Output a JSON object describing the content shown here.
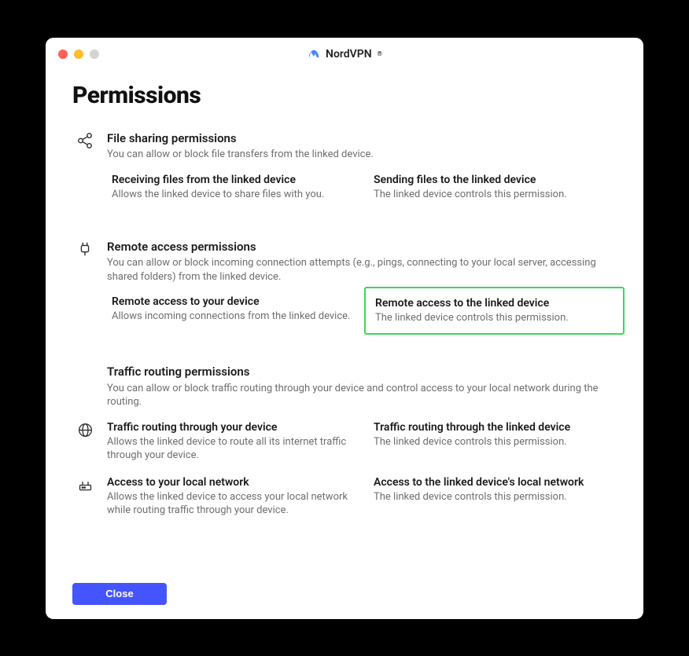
{
  "window": {
    "brand": "NordVPN",
    "page_title": "Permissions",
    "close_button_label": "Close"
  },
  "sections": {
    "file_sharing": {
      "title": "File sharing permissions",
      "desc": "You can allow or block file transfers from the linked device.",
      "left": {
        "title": "Receiving files from the linked device",
        "desc": "Allows the linked device to share files with you."
      },
      "right": {
        "title": "Sending files to the linked device",
        "desc": "The linked device controls this permission."
      }
    },
    "remote_access": {
      "title": "Remote access permissions",
      "desc": "You can allow or block incoming connection attempts (e.g., pings, connecting to your local server, accessing shared folders) from the linked device.",
      "left": {
        "title": "Remote access to your device",
        "desc": "Allows incoming connections from the linked device."
      },
      "right": {
        "title": "Remote access to the linked device",
        "desc": "The linked device controls this permission."
      }
    },
    "traffic": {
      "title": "Traffic routing permissions",
      "desc": "You can allow or block traffic routing through your device and control access to your local network during the routing.",
      "row1": {
        "left": {
          "title": "Traffic routing through your device",
          "desc": "Allows the linked device to route all its internet traffic through your device."
        },
        "right": {
          "title": "Traffic routing through the linked device",
          "desc": "The linked device controls this permission."
        }
      },
      "row2": {
        "left": {
          "title": "Access to your local network",
          "desc": "Allows the linked device to access your local network while routing traffic through your device."
        },
        "right": {
          "title": "Access to the linked device's local network",
          "desc": "The linked device controls this permission."
        }
      }
    }
  }
}
